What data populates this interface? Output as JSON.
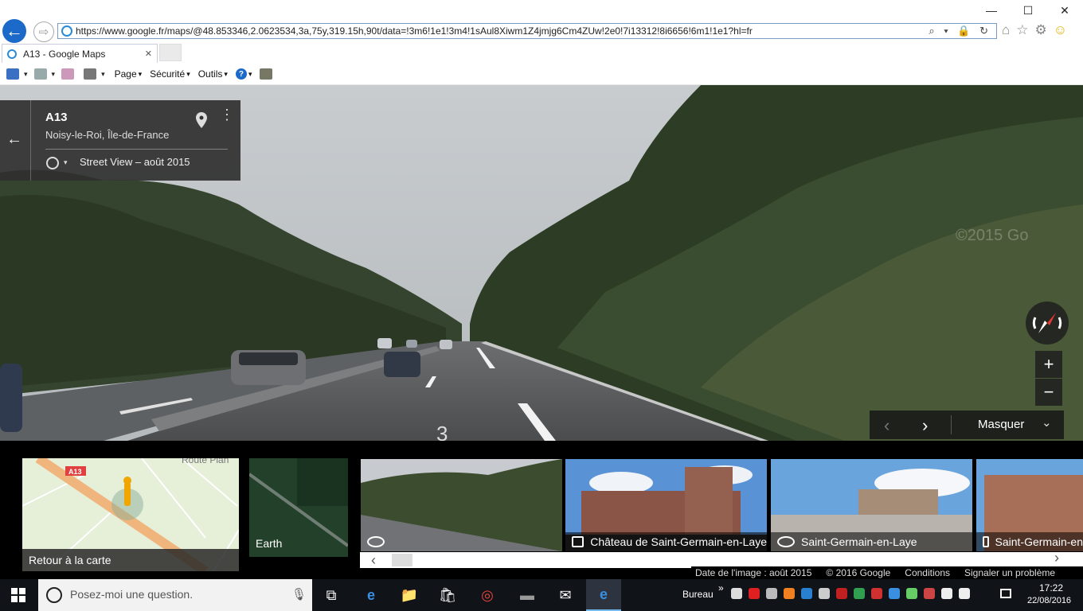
{
  "browser": {
    "url": "https://www.google.fr/maps/@48.853346,2.0623534,3a,75y,319.15h,90t/data=!3m6!1e1!3m4!1sAul8Xiwm1Z4jmjg6Cm4ZUw!2e0!7i13312!8i6656!6m1!1e1?hl=fr",
    "tab_title": "A13 - Google Maps",
    "window_controls": {
      "minimize": "—",
      "maximize": "☐",
      "close": "✕"
    },
    "nav": {
      "back": "←",
      "forward": "⇨"
    },
    "addr_tools": "⌕ ▾ 🔒 ↻",
    "right_icons": [
      "⌂",
      "☆",
      "⚙",
      "☺"
    ],
    "tab_close": "✕",
    "command_bar": {
      "page_label": "Page",
      "security_label": "Sécurité",
      "tools_label": "Outils",
      "help_label": "?"
    }
  },
  "streetview": {
    "title": "A13",
    "location": "Noisy-le-Roi, Île-de-France",
    "capture_date": "Street View – août 2015",
    "back_glyph": "←",
    "menu_glyph": "⋮",
    "watermark": "©2015 Go",
    "road_marking": "3",
    "zoom_in": "+",
    "zoom_out": "−",
    "film_prev": "‹",
    "film_next": "›",
    "film_hide": "Masquer",
    "film_hide_icon": "⌄"
  },
  "filmstrip": {
    "map_road_label": "A13",
    "map_place_label": "Route Plan",
    "map_back": "Retour à la carte",
    "earth_label": "Earth",
    "thumbs": [
      {
        "label": "",
        "icon": "pano"
      },
      {
        "label": "Château de Saint-Germain-en-Laye",
        "icon": "photo"
      },
      {
        "label": "Saint-Germain-en-Laye",
        "icon": "pano"
      },
      {
        "label": "Saint-Germain-en",
        "icon": "photo"
      }
    ],
    "scroll_left": "‹",
    "scroll_right": "›"
  },
  "footer": {
    "image_date": "Date de l'image : août 2015",
    "copyright": "© 2016 Google",
    "terms": "Conditions",
    "report": "Signaler un problème"
  },
  "taskbar": {
    "search_placeholder": "Posez-moi une question.",
    "mic": "🎙",
    "desktop_label": "Bureau",
    "overflow": "»",
    "time": "17:22",
    "date": "22/08/2016",
    "apps": [
      "⧉",
      "e",
      "📁",
      "🛍",
      "◎",
      "▬",
      "✉",
      "e"
    ]
  },
  "colors": {
    "ie_blue": "#1b6ac9",
    "maps_dark": "#303030",
    "taskbar": "#101318"
  }
}
